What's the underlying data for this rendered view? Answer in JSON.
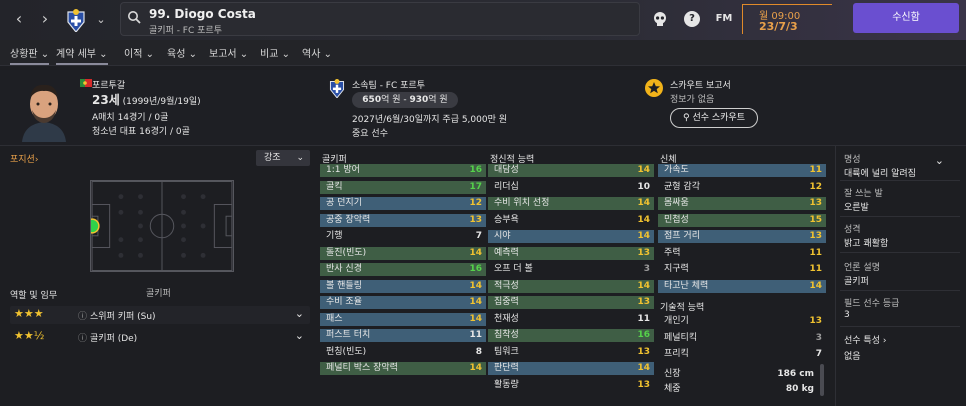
{
  "header": {
    "player_name": "99. Diogo Costa",
    "player_sub": "골키퍼 - FC 포르투",
    "fm_label": "FM",
    "date_day": "월 09:00",
    "date_full": "23/7/3",
    "inbox_label": "수신함",
    "help_label": "?"
  },
  "menu": {
    "items": [
      {
        "label": "상황판",
        "arrow": "⌄"
      },
      {
        "label": "계약 세부",
        "arrow": "⌄"
      },
      {
        "label": "이적",
        "arrow": "⌄"
      },
      {
        "label": "육성",
        "arrow": "⌄"
      },
      {
        "label": "보고서",
        "arrow": "⌄"
      },
      {
        "label": "비교",
        "arrow": "⌄"
      },
      {
        "label": "역사",
        "arrow": "⌄"
      }
    ]
  },
  "info": {
    "nation": "포르투갈",
    "age_bold": "23세",
    "age_rest": " (1999년/9월/19일)",
    "caps": "A매치 14경기 / 0골",
    "youth_caps": "청소년 대표 16경기 / 0골",
    "club_label": "소속팀 - FC 포르투",
    "value_a": "650",
    "value_unit_a": "억 원 - ",
    "value_b": "930",
    "value_unit_b": "억 원",
    "contract": "2027년/6월/30일까지 주급 5,000만 원",
    "status": "중요 선수",
    "scout_title": "스카우트 보고서",
    "scout_none": "정보가 없음",
    "scout_button": "선수 스카우트"
  },
  "left": {
    "position_label": "포지션",
    "position_arrow": "›",
    "emphasis_label": "강조",
    "emphasis_arrow": "⌄",
    "pitch_caption": "골키퍼",
    "roles_title": "역할 및 임무",
    "roles": [
      {
        "stars": "★★★",
        "name": "스위퍼 키퍼 (Su)",
        "stars_filled": 3
      },
      {
        "stars": "★★½",
        "name": "골키퍼 (De)",
        "stars_filled": 2.5
      }
    ]
  },
  "gk": {
    "title": "골키퍼",
    "rows": [
      {
        "label": "1:1 방어",
        "value": "16"
      },
      {
        "label": "골킥",
        "value": "17"
      },
      {
        "label": "공 던지기",
        "value": "12"
      },
      {
        "label": "공중 장악력",
        "value": "13"
      },
      {
        "label": "기행",
        "value": "7"
      },
      {
        "label": "돌진(빈도)",
        "value": "14"
      },
      {
        "label": "반사 신경",
        "value": "16"
      },
      {
        "label": "볼 핸들링",
        "value": "14"
      },
      {
        "label": "수비 조율",
        "value": "14"
      },
      {
        "label": "패스",
        "value": "14"
      },
      {
        "label": "퍼스트 터치",
        "value": "11"
      },
      {
        "label": "펀칭(빈도)",
        "value": "8"
      },
      {
        "label": "페널티 박스 장악력",
        "value": "14"
      }
    ]
  },
  "mental": {
    "title": "정신적 능력",
    "rows": [
      {
        "label": "대담성",
        "value": "14"
      },
      {
        "label": "리더십",
        "value": "10"
      },
      {
        "label": "수비 위치 선정",
        "value": "14"
      },
      {
        "label": "승부욕",
        "value": "14"
      },
      {
        "label": "시야",
        "value": "14"
      },
      {
        "label": "예측력",
        "value": "13"
      },
      {
        "label": "오프 더 볼",
        "value": "3"
      },
      {
        "label": "적극성",
        "value": "14"
      },
      {
        "label": "집중력",
        "value": "13"
      },
      {
        "label": "천재성",
        "value": "11"
      },
      {
        "label": "침착성",
        "value": "16"
      },
      {
        "label": "팀워크",
        "value": "13"
      },
      {
        "label": "판단력",
        "value": "14"
      },
      {
        "label": "활동량",
        "value": "13"
      }
    ]
  },
  "physical": {
    "title": "신체",
    "rows": [
      {
        "label": "가속도",
        "value": "11"
      },
      {
        "label": "균형 감각",
        "value": "12"
      },
      {
        "label": "몸싸움",
        "value": "13"
      },
      {
        "label": "민첩성",
        "value": "15"
      },
      {
        "label": "점프 거리",
        "value": "13"
      },
      {
        "label": "주력",
        "value": "11"
      },
      {
        "label": "지구력",
        "value": "11"
      },
      {
        "label": "타고난 체력",
        "value": "14"
      }
    ],
    "tech_title": "기술적 능력",
    "tech_rows": [
      {
        "label": "개인기",
        "value": "13"
      },
      {
        "label": "페널티킥",
        "value": "3"
      },
      {
        "label": "프리킥",
        "value": "7"
      }
    ],
    "height_label": "신장",
    "height_value": "186 cm",
    "weight_label": "체중",
    "weight_value": "80 kg"
  },
  "side": {
    "fame_title": "명성",
    "fame_value": "대륙에 널리 알려짐",
    "foot_title": "잘 쓰는 발",
    "foot_value": "오른발",
    "personality_title": "성격",
    "personality_value": "밝고 쾌활함",
    "media_title": "언론 설명",
    "media_value": "골키퍼",
    "field_title": "필드 선수 등급",
    "field_value": "3",
    "traits_title": "선수 특성",
    "traits_arrow": "›",
    "traits_value": "없음"
  },
  "colors": {
    "accent": "#6a4fd0",
    "green_value": "#55d24a",
    "yellow_value": "#f0c230",
    "highlight_blue": "#3f5f77",
    "highlight_green": "#3f5e45",
    "date_orange": "#e8a04a"
  }
}
